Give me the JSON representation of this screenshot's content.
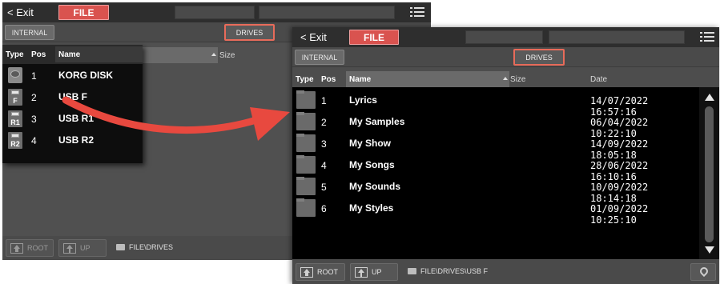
{
  "colors": {
    "accent": "#d9534f",
    "arrow": "#e8493f",
    "drives_border": "#e86b5a"
  },
  "back_panel": {
    "exit_label": "< Exit",
    "file_label": "FILE",
    "internal_label": "INTERNAL",
    "drives_label": "DRIVES",
    "columns": {
      "type": "Type",
      "pos": "Pos",
      "name": "Name",
      "size": "Size"
    },
    "drives": [
      {
        "pos": "1",
        "name": "KORG DISK",
        "icon": "disk-icon",
        "icon_label": ""
      },
      {
        "pos": "2",
        "name": "USB F",
        "icon": "usb-icon",
        "icon_label": "F"
      },
      {
        "pos": "3",
        "name": "USB R1",
        "icon": "usb-icon",
        "icon_label": "R1"
      },
      {
        "pos": "4",
        "name": "USB R2",
        "icon": "usb-icon",
        "icon_label": "R2"
      }
    ],
    "root_label": "ROOT",
    "up_label": "UP",
    "path": "FILE\\DRIVES"
  },
  "front_panel": {
    "exit_label": "< Exit",
    "file_label": "FILE",
    "internal_label": "INTERNAL",
    "drives_label": "DRIVES",
    "columns": {
      "type": "Type",
      "pos": "Pos",
      "name": "Name",
      "size": "Size",
      "date": "Date"
    },
    "files": [
      {
        "pos": "1",
        "name": "Lyrics",
        "date": "14/07/2022 16:57:16"
      },
      {
        "pos": "2",
        "name": "My Samples",
        "date": "06/04/2022 10:22:10"
      },
      {
        "pos": "3",
        "name": "My Show",
        "date": "14/09/2022 18:05:18"
      },
      {
        "pos": "4",
        "name": "My Songs",
        "date": "28/06/2022 16:10:16"
      },
      {
        "pos": "5",
        "name": "My Sounds",
        "date": "10/09/2022 18:14:18"
      },
      {
        "pos": "6",
        "name": "My Styles",
        "date": "01/09/2022 10:25:10"
      }
    ],
    "root_label": "ROOT",
    "up_label": "UP",
    "path": "FILE\\DRIVES\\USB F"
  }
}
